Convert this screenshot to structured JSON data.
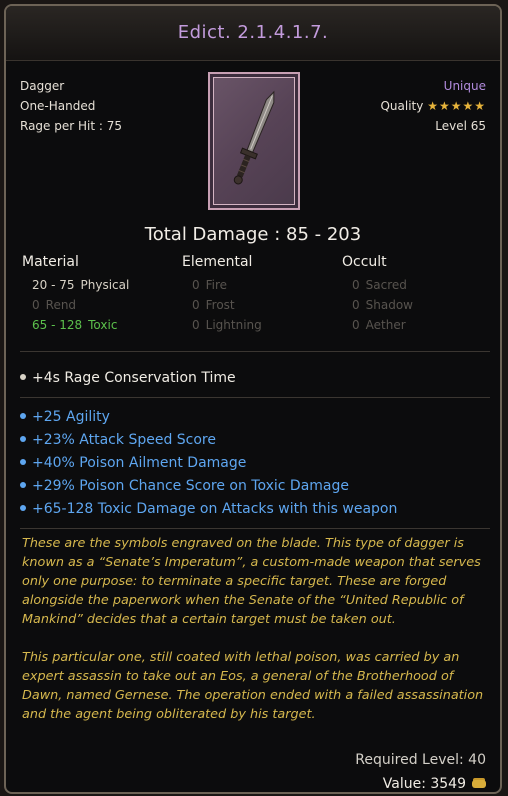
{
  "item": {
    "name": "Edict. 2.1.4.1.7.",
    "type": "Dagger",
    "handedness": "One-Handed",
    "rage_per_hit": "Rage per Hit : 75",
    "rarity": "Unique",
    "quality_label": "Quality",
    "quality_stars": "★★★★★",
    "level": "Level 65",
    "icon": "dagger-icon"
  },
  "damage": {
    "total": "Total Damage : 85 - 203",
    "columns": [
      {
        "header": "Material",
        "rows": [
          {
            "value": "20 - 75",
            "label": "Physical",
            "state": "active"
          },
          {
            "value": "0",
            "label": "Rend",
            "state": "inactive"
          },
          {
            "value": "65 - 128",
            "label": "Toxic",
            "state": "toxic"
          }
        ]
      },
      {
        "header": "Elemental",
        "rows": [
          {
            "value": "0",
            "label": "Fire",
            "state": "inactive"
          },
          {
            "value": "0",
            "label": "Frost",
            "state": "inactive"
          },
          {
            "value": "0",
            "label": "Lightning",
            "state": "inactive"
          }
        ]
      },
      {
        "header": "Occult",
        "rows": [
          {
            "value": "0",
            "label": "Sacred",
            "state": "inactive"
          },
          {
            "value": "0",
            "label": "Shadow",
            "state": "inactive"
          },
          {
            "value": "0",
            "label": "Aether",
            "state": "inactive"
          }
        ]
      }
    ]
  },
  "base_property": "+4s Rage Conservation Time",
  "modifiers": [
    "+25 Agility",
    "+23% Attack Speed Score",
    "+40% Poison Ailment Damage",
    "+29% Poison Chance Score on Toxic Damage",
    "+65-128 Toxic Damage on Attacks with this weapon"
  ],
  "lore": [
    "These are the symbols engraved on the blade. This type of dagger is known as a “Senate’s Imperatum”, a custom-made weapon that serves only one purpose: to terminate a specific target. These are forged alongside the paperwork when the Senate of the “United Republic of Mankind” decides that a certain target must be taken out.",
    "This particular one, still coated with lethal poison, was carried by an expert assassin to take out an Eos, a general of the Brotherhood of Dawn, named Gernese. The operation ended with a failed assassination and the agent being obliterated by his target."
  ],
  "required_level": "Required Level: 40",
  "value": "Value: 3549",
  "colors": {
    "title": "#c39bdc",
    "rarity": "#b38cde",
    "stars": "#e7b43b",
    "toxic": "#5cc04c",
    "modifier": "#5ea6f0",
    "lore": "#d6b84e"
  }
}
